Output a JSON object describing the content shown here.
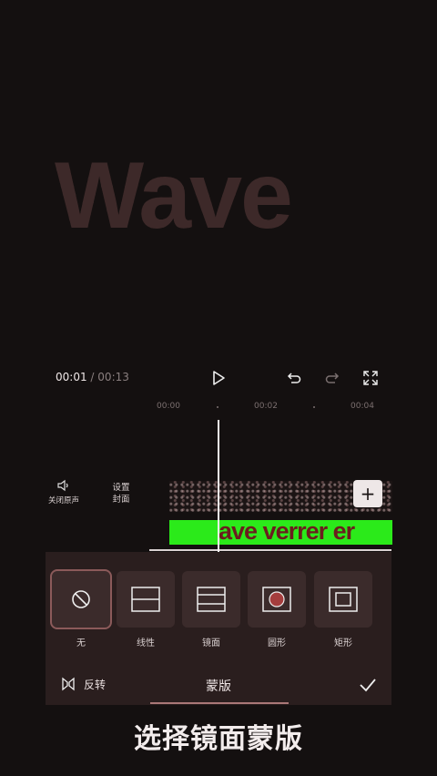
{
  "preview": {
    "overlay_text": "Wave"
  },
  "playback": {
    "current_time": "00:01",
    "separator": "/",
    "total_time": "00:13"
  },
  "ruler": {
    "labels": [
      "00:00",
      "00:02",
      "00:04"
    ]
  },
  "tracks": {
    "audio_toggle_label": "关闭原声",
    "cover_label_line1": "设置",
    "cover_label_line2": "封面",
    "add_clip_symbol": "+",
    "text_track_text": "ave verrer er"
  },
  "mask_panel": {
    "title": "蒙版",
    "invert_label": "反转",
    "options": [
      {
        "label": "无",
        "icon": "none-icon",
        "selected": true
      },
      {
        "label": "线性",
        "icon": "linear-mask-icon",
        "selected": false
      },
      {
        "label": "镜面",
        "icon": "mirror-mask-icon",
        "selected": false
      },
      {
        "label": "圆形",
        "icon": "circle-mask-icon",
        "selected": false
      },
      {
        "label": "矩形",
        "icon": "rectangle-mask-icon",
        "selected": false
      }
    ]
  },
  "caption": "选择镜面蒙版",
  "colors": {
    "text_track": "#2bea1a",
    "selected_outline": "#8b5a5a",
    "panel_bg": "#2a1e1e"
  }
}
